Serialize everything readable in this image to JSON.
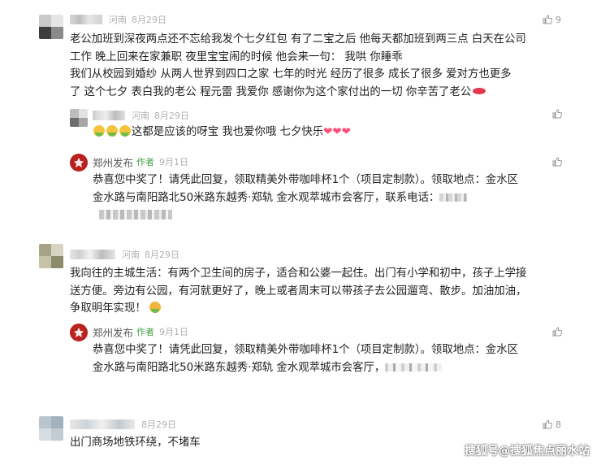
{
  "comments": [
    {
      "location": "河南",
      "date": "8月29日",
      "likes": "9",
      "text_lines": [
        "老公加班到深夜两点还不忘给我发个七夕红包 有了二宝之后 他每天都加班到两三点 白天在公司",
        "工作 晚上回来在家兼职 夜里宝宝闹的时候 他会来一句： 我哄 你睡乖",
        "我们从校园到婚纱 从两人世界到四口之家 七年的时光 经历了很多 成长了很多 爱对方也更多",
        "了 这个七夕 表白我的老公 程元雷 我爱你 感谢你为这个家付出的一切 你辛苦了老公"
      ],
      "replies": [
        {
          "location": "河南",
          "date": "8月29日",
          "text": "这都是应该的呀宝  我也爱你哦  七夕快乐",
          "hearts": "❤❤❤"
        },
        {
          "name": "郑州发布",
          "author_tag": "作者",
          "date": "9月1日",
          "text_lines": [
            "恭喜您中奖了！请凭此回复，领取精美外带咖啡杯1个（项目定制款）。领取地点：金水区",
            "金水路与南阳路北50米路东越秀·郑轨 金水观萃城市会客厅，联系电话："
          ]
        }
      ]
    },
    {
      "location": "河南",
      "date": "8月29日",
      "text_lines": [
        "我向往的主城生活：有两个卫生间的房子，适合和公婆一起住。出门有小学和初中，孩子上学接",
        "送方便。旁边有公园，有河就更好了，晚上或者周末可以带孩子去公园遛弯、散步。加油加油，",
        "争取明年实现！"
      ],
      "replies": [
        {
          "name": "郑州发布",
          "author_tag": "作者",
          "date": "9月1日",
          "text_lines": [
            "恭喜您中奖了！请凭此回复，领取精美外带咖啡杯1个（项目定制款）。领取地点：金水区",
            "金水路与南阳路北50米路东越秀·郑轨 金水观萃城市会客厅，"
          ]
        }
      ]
    },
    {
      "location": "河南",
      "date": "8月29日",
      "likes": "8",
      "text_lines": [
        "出门商场地铁环绕，不堵车"
      ]
    }
  ],
  "watermark": "搜狐号@搜狐焦点丽水站",
  "icons": {
    "like": "thumbs-up-icon",
    "publisher_logo": "zhengzhou-fabu-logo"
  },
  "colors": {
    "author_tag": "#43a047",
    "publisher_logo_bg": "#b8211c",
    "heart": "#ff4f79",
    "meta_gray": "#b0b0b0"
  }
}
